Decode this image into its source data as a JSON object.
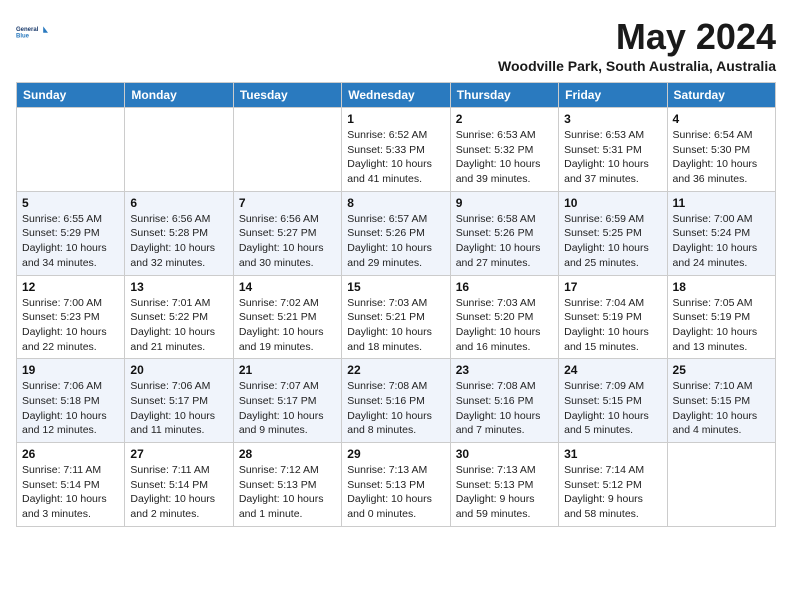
{
  "header": {
    "logo_line1": "General",
    "logo_line2": "Blue",
    "month": "May 2024",
    "location": "Woodville Park, South Australia, Australia"
  },
  "weekdays": [
    "Sunday",
    "Monday",
    "Tuesday",
    "Wednesday",
    "Thursday",
    "Friday",
    "Saturday"
  ],
  "weeks": [
    [
      {
        "day": "",
        "info": ""
      },
      {
        "day": "",
        "info": ""
      },
      {
        "day": "",
        "info": ""
      },
      {
        "day": "1",
        "info": "Sunrise: 6:52 AM\nSunset: 5:33 PM\nDaylight: 10 hours\nand 41 minutes."
      },
      {
        "day": "2",
        "info": "Sunrise: 6:53 AM\nSunset: 5:32 PM\nDaylight: 10 hours\nand 39 minutes."
      },
      {
        "day": "3",
        "info": "Sunrise: 6:53 AM\nSunset: 5:31 PM\nDaylight: 10 hours\nand 37 minutes."
      },
      {
        "day": "4",
        "info": "Sunrise: 6:54 AM\nSunset: 5:30 PM\nDaylight: 10 hours\nand 36 minutes."
      }
    ],
    [
      {
        "day": "5",
        "info": "Sunrise: 6:55 AM\nSunset: 5:29 PM\nDaylight: 10 hours\nand 34 minutes."
      },
      {
        "day": "6",
        "info": "Sunrise: 6:56 AM\nSunset: 5:28 PM\nDaylight: 10 hours\nand 32 minutes."
      },
      {
        "day": "7",
        "info": "Sunrise: 6:56 AM\nSunset: 5:27 PM\nDaylight: 10 hours\nand 30 minutes."
      },
      {
        "day": "8",
        "info": "Sunrise: 6:57 AM\nSunset: 5:26 PM\nDaylight: 10 hours\nand 29 minutes."
      },
      {
        "day": "9",
        "info": "Sunrise: 6:58 AM\nSunset: 5:26 PM\nDaylight: 10 hours\nand 27 minutes."
      },
      {
        "day": "10",
        "info": "Sunrise: 6:59 AM\nSunset: 5:25 PM\nDaylight: 10 hours\nand 25 minutes."
      },
      {
        "day": "11",
        "info": "Sunrise: 7:00 AM\nSunset: 5:24 PM\nDaylight: 10 hours\nand 24 minutes."
      }
    ],
    [
      {
        "day": "12",
        "info": "Sunrise: 7:00 AM\nSunset: 5:23 PM\nDaylight: 10 hours\nand 22 minutes."
      },
      {
        "day": "13",
        "info": "Sunrise: 7:01 AM\nSunset: 5:22 PM\nDaylight: 10 hours\nand 21 minutes."
      },
      {
        "day": "14",
        "info": "Sunrise: 7:02 AM\nSunset: 5:21 PM\nDaylight: 10 hours\nand 19 minutes."
      },
      {
        "day": "15",
        "info": "Sunrise: 7:03 AM\nSunset: 5:21 PM\nDaylight: 10 hours\nand 18 minutes."
      },
      {
        "day": "16",
        "info": "Sunrise: 7:03 AM\nSunset: 5:20 PM\nDaylight: 10 hours\nand 16 minutes."
      },
      {
        "day": "17",
        "info": "Sunrise: 7:04 AM\nSunset: 5:19 PM\nDaylight: 10 hours\nand 15 minutes."
      },
      {
        "day": "18",
        "info": "Sunrise: 7:05 AM\nSunset: 5:19 PM\nDaylight: 10 hours\nand 13 minutes."
      }
    ],
    [
      {
        "day": "19",
        "info": "Sunrise: 7:06 AM\nSunset: 5:18 PM\nDaylight: 10 hours\nand 12 minutes."
      },
      {
        "day": "20",
        "info": "Sunrise: 7:06 AM\nSunset: 5:17 PM\nDaylight: 10 hours\nand 11 minutes."
      },
      {
        "day": "21",
        "info": "Sunrise: 7:07 AM\nSunset: 5:17 PM\nDaylight: 10 hours\nand 9 minutes."
      },
      {
        "day": "22",
        "info": "Sunrise: 7:08 AM\nSunset: 5:16 PM\nDaylight: 10 hours\nand 8 minutes."
      },
      {
        "day": "23",
        "info": "Sunrise: 7:08 AM\nSunset: 5:16 PM\nDaylight: 10 hours\nand 7 minutes."
      },
      {
        "day": "24",
        "info": "Sunrise: 7:09 AM\nSunset: 5:15 PM\nDaylight: 10 hours\nand 5 minutes."
      },
      {
        "day": "25",
        "info": "Sunrise: 7:10 AM\nSunset: 5:15 PM\nDaylight: 10 hours\nand 4 minutes."
      }
    ],
    [
      {
        "day": "26",
        "info": "Sunrise: 7:11 AM\nSunset: 5:14 PM\nDaylight: 10 hours\nand 3 minutes."
      },
      {
        "day": "27",
        "info": "Sunrise: 7:11 AM\nSunset: 5:14 PM\nDaylight: 10 hours\nand 2 minutes."
      },
      {
        "day": "28",
        "info": "Sunrise: 7:12 AM\nSunset: 5:13 PM\nDaylight: 10 hours\nand 1 minute."
      },
      {
        "day": "29",
        "info": "Sunrise: 7:13 AM\nSunset: 5:13 PM\nDaylight: 10 hours\nand 0 minutes."
      },
      {
        "day": "30",
        "info": "Sunrise: 7:13 AM\nSunset: 5:13 PM\nDaylight: 9 hours\nand 59 minutes."
      },
      {
        "day": "31",
        "info": "Sunrise: 7:14 AM\nSunset: 5:12 PM\nDaylight: 9 hours\nand 58 minutes."
      },
      {
        "day": "",
        "info": ""
      }
    ]
  ]
}
